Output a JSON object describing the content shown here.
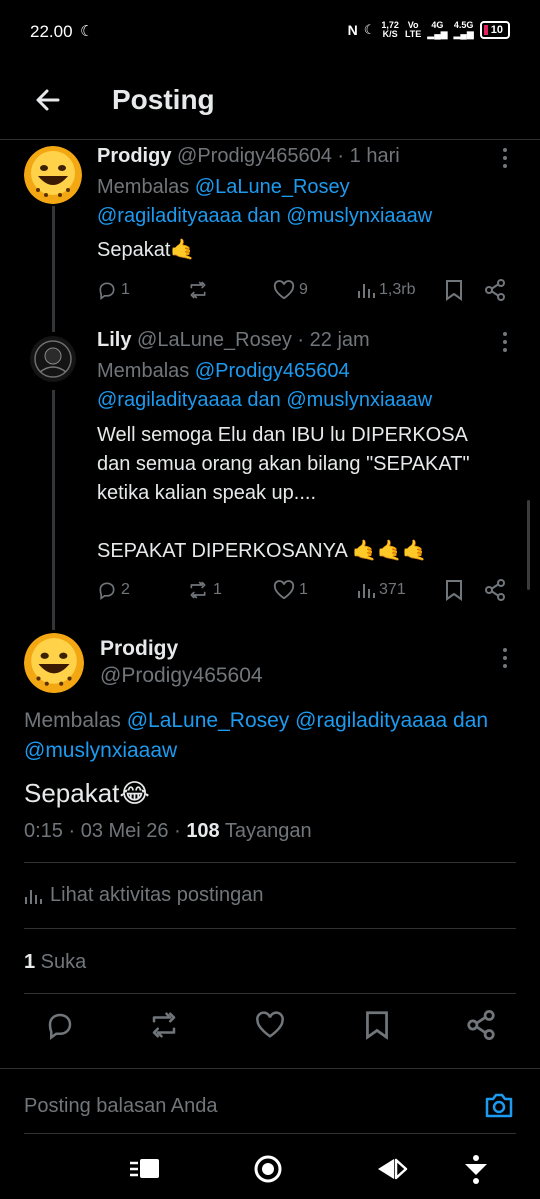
{
  "status_bar": {
    "time": "22.00",
    "net_speed_top": "1,72",
    "net_speed_bottom": "K/S",
    "volte_top": "Vo",
    "volte_bottom": "LTE",
    "sig1": "4G",
    "sig2": "4.5G",
    "battery": "10"
  },
  "header": {
    "title": "Posting"
  },
  "thread": [
    {
      "name": "Prodigy",
      "meta": "@Prodigy465604 · 1 hari",
      "reply_prefix": "Membalas ",
      "reply_to_line1": "@LaLune_Rosey",
      "reply_to_line2": "@ragiladityaaaa dan @muslynxiaaaw",
      "text_lines": [
        "Sepakat🤙"
      ],
      "replies": "1",
      "retweets": "",
      "likes": "9",
      "views": "1,3rb"
    },
    {
      "name": "Lily",
      "meta": "@LaLune_Rosey · 22 jam",
      "reply_prefix": "Membalas ",
      "reply_to_line1": "@Prodigy465604",
      "reply_to_line2": "@ragiladityaaaa dan @muslynxiaaaw",
      "text_lines": [
        "Well semoga Elu dan IBU lu DIPERKOSA",
        "dan semua orang akan bilang \"SEPAKAT\"",
        "ketika kalian speak up....",
        "",
        "SEPAKAT DIPERKOSANYA 🤙🤙🤙"
      ],
      "replies": "2",
      "retweets": "1",
      "likes": "1",
      "views": "371"
    }
  ],
  "main": {
    "name": "Prodigy",
    "handle": "@Prodigy465604",
    "reply_prefix": "Membalas ",
    "reply_to_line1": "@LaLune_Rosey @ragiladityaaaa dan",
    "reply_to_line2": "@muslynxiaaaw",
    "text": "Sepakat😂",
    "meta_time": "0:15 · 03 Mei 26 · ",
    "meta_views": "108",
    "meta_views_label": " Tayangan",
    "activity_label": "Lihat aktivitas postingan",
    "like_count": "1",
    "like_label": " Suka"
  },
  "reply_box": {
    "placeholder": "Posting balasan Anda"
  },
  "colors": {
    "background": "#000000",
    "text": "#e7e9ea",
    "muted": "#71767b",
    "link": "#1d9bf0"
  }
}
